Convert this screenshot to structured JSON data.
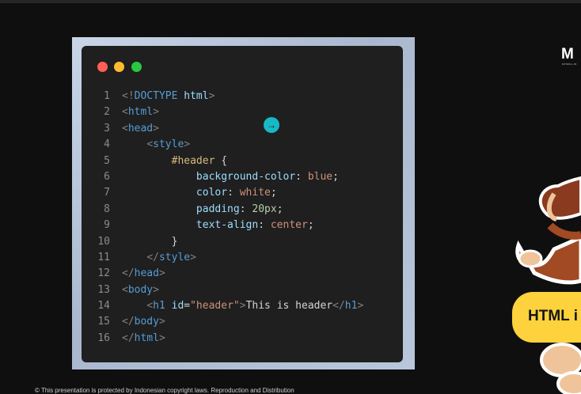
{
  "editor": {
    "window_controls": [
      "close",
      "minimize",
      "maximize"
    ],
    "lines": [
      {
        "n": "1",
        "tokens": [
          [
            "punc",
            "<!"
          ],
          [
            "tag",
            "DOCTYPE"
          ],
          [
            "plain",
            " "
          ],
          [
            "kw",
            "html"
          ],
          [
            "punc",
            ">"
          ]
        ]
      },
      {
        "n": "2",
        "tokens": [
          [
            "punc",
            "<"
          ],
          [
            "tag",
            "html"
          ],
          [
            "punc",
            ">"
          ]
        ]
      },
      {
        "n": "3",
        "tokens": [
          [
            "punc",
            "<"
          ],
          [
            "tag",
            "head"
          ],
          [
            "punc",
            ">"
          ]
        ]
      },
      {
        "n": "4",
        "tokens": [
          [
            "plain",
            "    "
          ],
          [
            "punc",
            "<"
          ],
          [
            "tag",
            "style"
          ],
          [
            "punc",
            ">"
          ]
        ]
      },
      {
        "n": "5",
        "tokens": [
          [
            "plain",
            "        "
          ],
          [
            "sel",
            "#header"
          ],
          [
            "plain",
            " {"
          ]
        ]
      },
      {
        "n": "6",
        "tokens": [
          [
            "plain",
            "            "
          ],
          [
            "prop",
            "background-color"
          ],
          [
            "plain",
            ": "
          ],
          [
            "val",
            "blue"
          ],
          [
            "plain",
            ";"
          ]
        ]
      },
      {
        "n": "7",
        "tokens": [
          [
            "plain",
            "            "
          ],
          [
            "prop",
            "color"
          ],
          [
            "plain",
            ": "
          ],
          [
            "val",
            "white"
          ],
          [
            "plain",
            ";"
          ]
        ]
      },
      {
        "n": "8",
        "tokens": [
          [
            "plain",
            "            "
          ],
          [
            "prop",
            "padding"
          ],
          [
            "plain",
            ": "
          ],
          [
            "num",
            "20px"
          ],
          [
            "plain",
            ";"
          ]
        ]
      },
      {
        "n": "9",
        "tokens": [
          [
            "plain",
            "            "
          ],
          [
            "prop",
            "text-align"
          ],
          [
            "plain",
            ": "
          ],
          [
            "val",
            "center"
          ],
          [
            "plain",
            ";"
          ]
        ]
      },
      {
        "n": "10",
        "tokens": [
          [
            "plain",
            "        }"
          ]
        ]
      },
      {
        "n": "11",
        "tokens": [
          [
            "plain",
            "    "
          ],
          [
            "punc",
            "</"
          ],
          [
            "tag",
            "style"
          ],
          [
            "punc",
            ">"
          ]
        ]
      },
      {
        "n": "12",
        "tokens": [
          [
            "punc",
            "</"
          ],
          [
            "tag",
            "head"
          ],
          [
            "punc",
            ">"
          ]
        ]
      },
      {
        "n": "13",
        "tokens": [
          [
            "punc",
            "<"
          ],
          [
            "tag",
            "body"
          ],
          [
            "punc",
            ">"
          ]
        ]
      },
      {
        "n": "14",
        "tokens": [
          [
            "plain",
            "    "
          ],
          [
            "punc",
            "<"
          ],
          [
            "tag",
            "h1"
          ],
          [
            "plain",
            " "
          ],
          [
            "attr",
            "id"
          ],
          [
            "plain",
            "="
          ],
          [
            "val",
            "\"header\""
          ],
          [
            "punc",
            ">"
          ],
          [
            "plain",
            "This is header"
          ],
          [
            "punc",
            "</"
          ],
          [
            "tag",
            "h1"
          ],
          [
            "punc",
            ">"
          ]
        ]
      },
      {
        "n": "15",
        "tokens": [
          [
            "punc",
            "</"
          ],
          [
            "tag",
            "body"
          ],
          [
            "punc",
            ">"
          ]
        ]
      },
      {
        "n": "16",
        "tokens": [
          [
            "punc",
            "</"
          ],
          [
            "tag",
            "html"
          ],
          [
            "punc",
            ">"
          ]
        ]
      }
    ]
  },
  "cursor_badge_icon": "arrow-right-icon",
  "logo": {
    "text": "M",
    "subtext": "MYSKILL.ID"
  },
  "badge": {
    "text": "HTML i"
  },
  "footer": {
    "text": "© This presentation is protected by Indonesian copyright laws. Reproduction and Distribution"
  },
  "colors": {
    "accent_badge": "#fdd23c",
    "cursor": "#18b9c4",
    "editor_bg": "#1f1f1f"
  }
}
